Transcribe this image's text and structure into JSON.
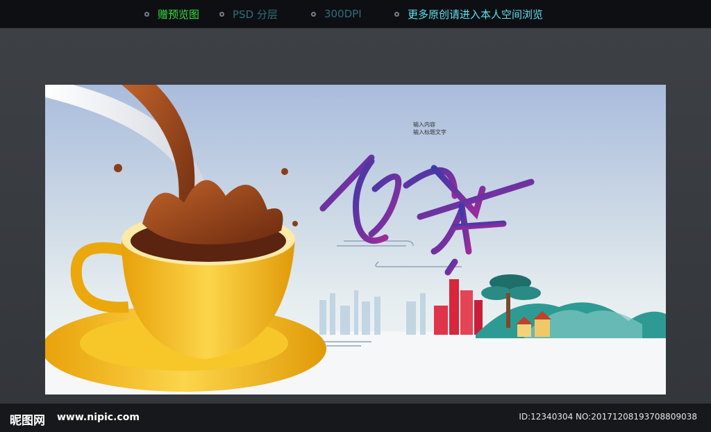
{
  "header": {
    "items": [
      "赠预览图",
      "PSD 分层",
      "300DPI",
      "更多原创请进入本人空间浏览"
    ]
  },
  "poster": {
    "title": "奶茶",
    "small_text_1": "输入内容",
    "small_text_2": "输入标题文字"
  },
  "footer": {
    "logo": "昵图网",
    "url": "www.nipic.com",
    "image_id": "ID:12340304 NO:20171208193708809038"
  },
  "colors": {
    "title_purple": "#5a2fa0",
    "cup_yellow": "#f3b416",
    "tea_brown": "#8a3d18",
    "header_green": "#30e040",
    "header_cyan": "#5ee0f0"
  }
}
